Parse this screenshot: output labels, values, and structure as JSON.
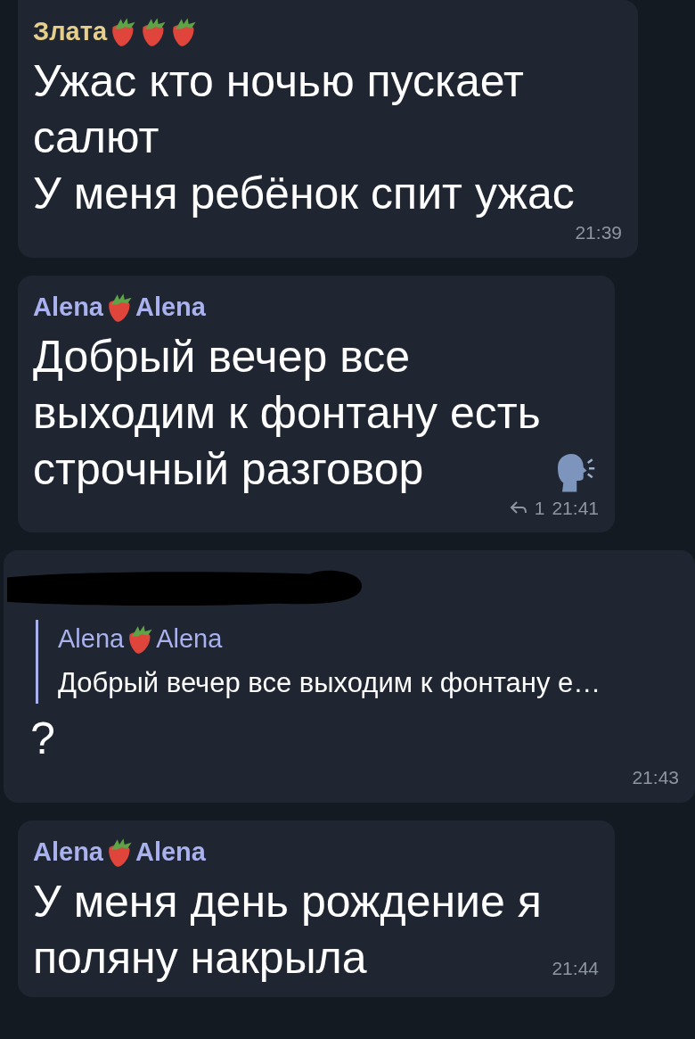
{
  "messages": [
    {
      "sender": [
        {
          "kind": "text",
          "text": "Злата"
        },
        {
          "kind": "strawberry"
        },
        {
          "kind": "strawberry"
        },
        {
          "kind": "strawberry"
        }
      ],
      "color": "#e6cf8a",
      "lines": [
        "Ужас кто ночью пускает",
        "салют",
        "У меня ребёнок спит ужас"
      ],
      "time": "21:39"
    },
    {
      "sender": [
        {
          "kind": "text",
          "text": "Alena"
        },
        {
          "kind": "strawberry"
        },
        {
          "kind": "text",
          "text": "Alena"
        }
      ],
      "color": "#a9b1ee",
      "lines": [
        "Добрый вечер все",
        "выходим к фонтану есть",
        "строчный разговор"
      ],
      "end_icons": [
        {
          "kind": "speaking-head"
        }
      ],
      "replies": "1",
      "time": "21:41"
    },
    {
      "sender": [
        {
          "kind": "redacted"
        }
      ],
      "reply_to": {
        "sender": [
          {
            "kind": "text",
            "text": "Alena"
          },
          {
            "kind": "strawberry"
          },
          {
            "kind": "text",
            "text": "Alena"
          }
        ],
        "color": "#a9b1ee",
        "text": "Добрый вечер все выходим к фонтану е…"
      },
      "lines": [
        "?"
      ],
      "time": "21:43"
    },
    {
      "sender": [
        {
          "kind": "text",
          "text": "Alena"
        },
        {
          "kind": "strawberry"
        },
        {
          "kind": "text",
          "text": "Alena"
        }
      ],
      "color": "#a9b1ee",
      "lines": [
        "У меня день рождение я",
        "поляну накрыла"
      ],
      "time": "21:44"
    }
  ]
}
